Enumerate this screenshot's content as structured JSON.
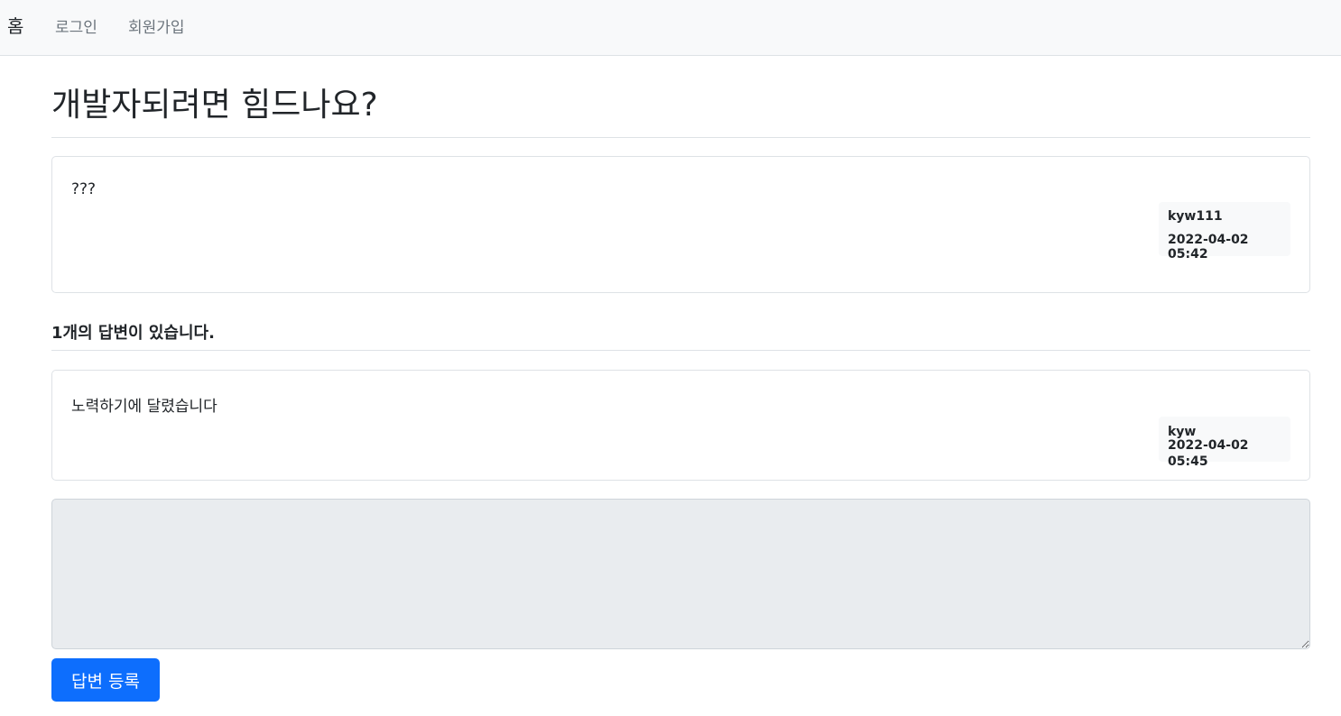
{
  "navbar": {
    "brand": "홈",
    "links": [
      "로그인",
      "회원가입"
    ]
  },
  "question": {
    "title": "개발자되려면 힘드나요?",
    "content": "???",
    "author": "kyw111",
    "date": "2022-04-02 05:42"
  },
  "answer_count_text": "1개의 답변이 있습니다.",
  "answers": [
    {
      "content": "노력하기에 달렸습니다",
      "author": "kyw",
      "date": "2022-04-02 05:45"
    }
  ],
  "answer_form": {
    "value": "",
    "submit_label": "답변 등록"
  },
  "colors": {
    "primary": "#0d6efd",
    "navbar_bg": "#f8f9fa",
    "textarea_bg": "#e9ecef"
  }
}
